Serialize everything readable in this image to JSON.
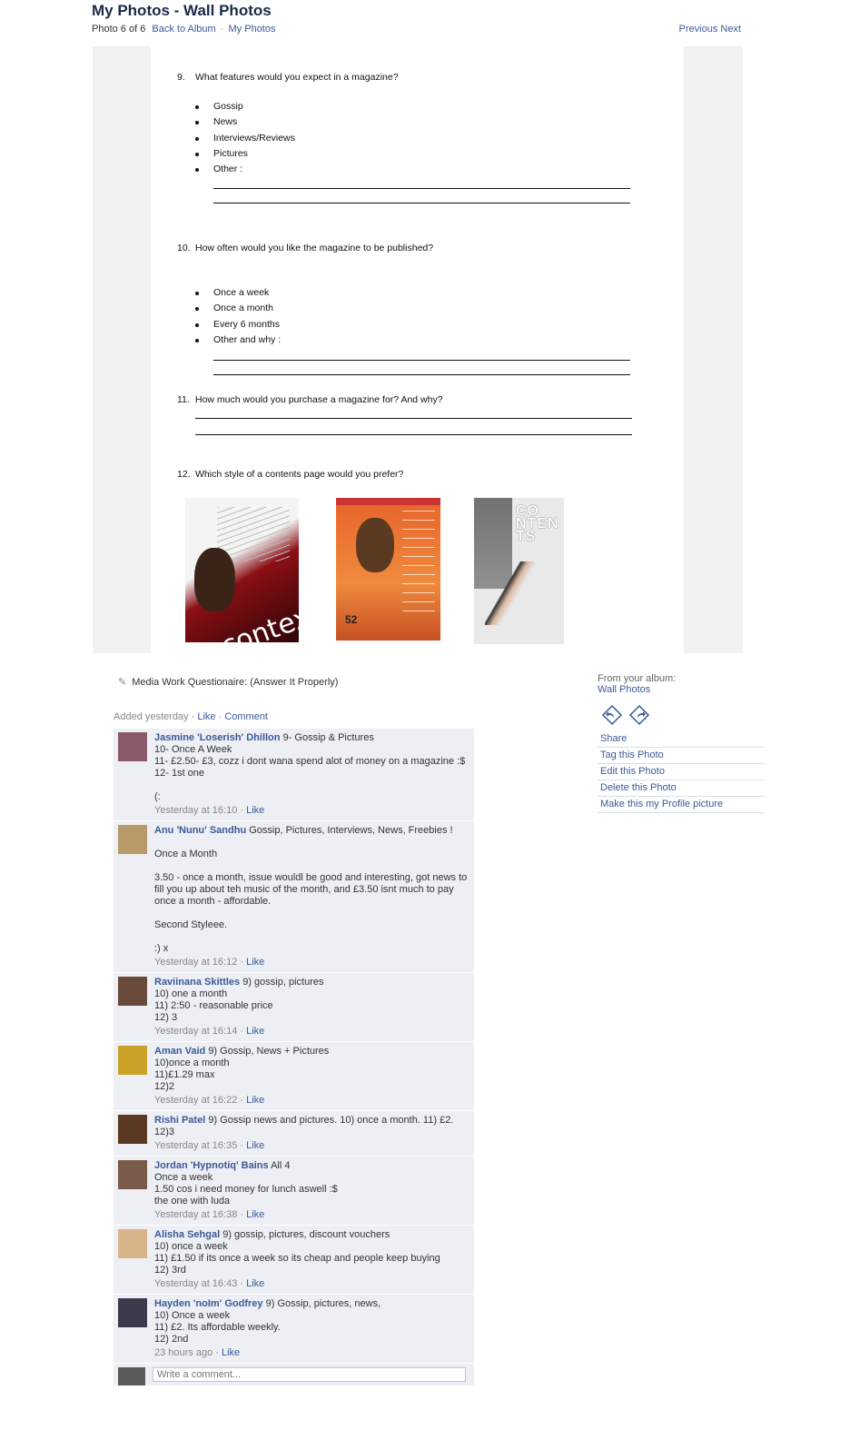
{
  "header": {
    "title": "My Photos - Wall Photos",
    "photo_count": "Photo 6 of 6",
    "back_link": "Back to Album",
    "sep": "·",
    "my_photos_link": "My Photos",
    "previous": "Previous",
    "next": "Next"
  },
  "questionnaire": {
    "q9": {
      "num": "9.",
      "text": "What features would you expect in a magazine?",
      "options": [
        "Gossip",
        "News",
        "Interviews/Reviews",
        "Pictures",
        "Other :"
      ]
    },
    "q10": {
      "num": "10.",
      "text": "How often would you like the magazine to be published?",
      "options": [
        "Once a week",
        "Once a month",
        "Every 6 months",
        "Other and why :"
      ]
    },
    "q11": {
      "num": "11.",
      "text": "How much would you purchase a magazine for? And why?"
    },
    "q12": {
      "num": "12.",
      "text": "Which style of a contents page would you prefer?"
    },
    "thumbs": {
      "t1_text": "contex",
      "t2_num": "52",
      "t3_text": "CO NTEN TS"
    }
  },
  "caption": "Media Work Questionaire: (Answer It Properly)",
  "added": {
    "text": "Added yesterday",
    "like": "Like",
    "comment": "Comment"
  },
  "comments": [
    {
      "name": "Jasmine 'Loserish' Dhillon",
      "body": "9- Gossip & Pictures\n10- Once A Week\n11- £2.50- £3, cozz i dont wana spend alot of money on a magazine :$\n12- 1st one\n\n(:",
      "time": "Yesterday at 16:10",
      "like": "Like",
      "avatar": "#8a5a6a"
    },
    {
      "name": "Anu 'Nunu' Sandhu",
      "body": "Gossip, Pictures, Interviews, News, Freebies !\n\nOnce a Month\n\n3.50 - once a month, issue wouldl be good and interesting, got news to fill you up about teh music of the month, and £3.50 isnt much to pay once a month - affordable.\n\nSecond Styleee.\n\n:) x",
      "time": "Yesterday at 16:12",
      "like": "Like",
      "avatar": "#b89a6a"
    },
    {
      "name": "Raviinana Skittles",
      "body": "9) gossip, pictures\n10) one a month\n11) 2:50 - reasonable price\n12) 3",
      "time": "Yesterday at 16:14",
      "like": "Like",
      "avatar": "#6a4a3a"
    },
    {
      "name": "Aman Vaid",
      "body": "9) Gossip, News + Pictures\n10)once a month\n11)£1.29 max\n12)2",
      "time": "Yesterday at 16:22",
      "like": "Like",
      "avatar": "#c9a227"
    },
    {
      "name": "Rishi Patel",
      "body": "9) Gossip news and pictures. 10) once a month. 11) £2. 12)3",
      "time": "Yesterday at 16:35",
      "like": "Like",
      "avatar": "#5a3a22"
    },
    {
      "name": "Jordan 'Hypnotiq' Bains",
      "body": "All 4\nOnce a week\n1.50 cos i need money for lunch aswell :$\nthe one with luda",
      "time": "Yesterday at 16:38",
      "like": "Like",
      "avatar": "#7a5a4a"
    },
    {
      "name": "Alisha Sehgal",
      "body": "9) gossip, pictures, discount vouchers\n10) once a week\n11) £1.50 if its once a week so its cheap and people keep buying\n12) 3rd",
      "time": "Yesterday at 16:43",
      "like": "Like",
      "avatar": "#d8b48a"
    },
    {
      "name": "Hayden 'noIm' Godfrey",
      "body": "9) Gossip, pictures, news,\n10) Once a week\n11) £2. Its affordable weekly.\n12) 2nd",
      "time": "23 hours ago",
      "like": "Like",
      "avatar": "#3a3a4a"
    }
  ],
  "write_placeholder": "Write a comment...",
  "sidebar": {
    "from": "From your album:",
    "album": "Wall Photos",
    "actions": [
      "Share",
      "Tag this Photo",
      "Edit this Photo",
      "Delete this Photo",
      "Make this my Profile picture"
    ]
  }
}
